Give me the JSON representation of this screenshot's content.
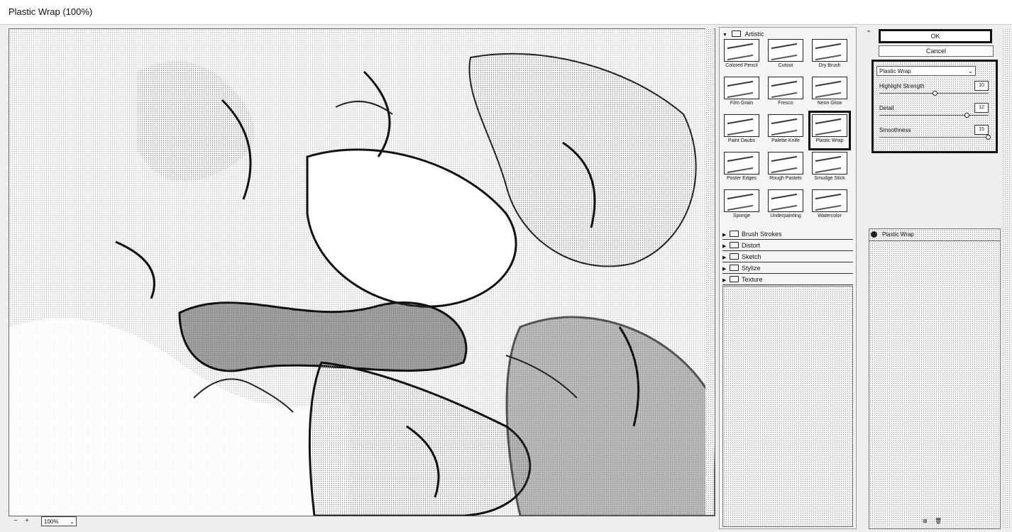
{
  "window": {
    "title": "Plastic Wrap (100%)"
  },
  "preview": {
    "zoom": "100%"
  },
  "gallery": {
    "open_category": "Artistic",
    "thumbnails": [
      "Colored Pencil",
      "Cutout",
      "Dry Brush",
      "Film Grain",
      "Fresco",
      "Neon Glow",
      "Paint Daubs",
      "Palette Knife",
      "Plastic Wrap",
      "Poster Edges",
      "Rough Pastels",
      "Smudge Stick",
      "Sponge",
      "Underpainting",
      "Watercolor"
    ],
    "selected": "Plastic Wrap",
    "categories": [
      "Brush Strokes",
      "Distort",
      "Sketch",
      "Stylize",
      "Texture"
    ]
  },
  "buttons": {
    "ok": "OK",
    "cancel": "Cancel"
  },
  "settings": {
    "filter": "Plastic Wrap",
    "params": [
      {
        "label": "Highlight Strength",
        "value": "10",
        "fraction": 0.5
      },
      {
        "label": "Detail",
        "value": "12",
        "fraction": 0.8
      },
      {
        "label": "Smoothness",
        "value": "15",
        "fraction": 1.0
      }
    ]
  },
  "layers": {
    "items": [
      "Plastic Wrap"
    ]
  }
}
